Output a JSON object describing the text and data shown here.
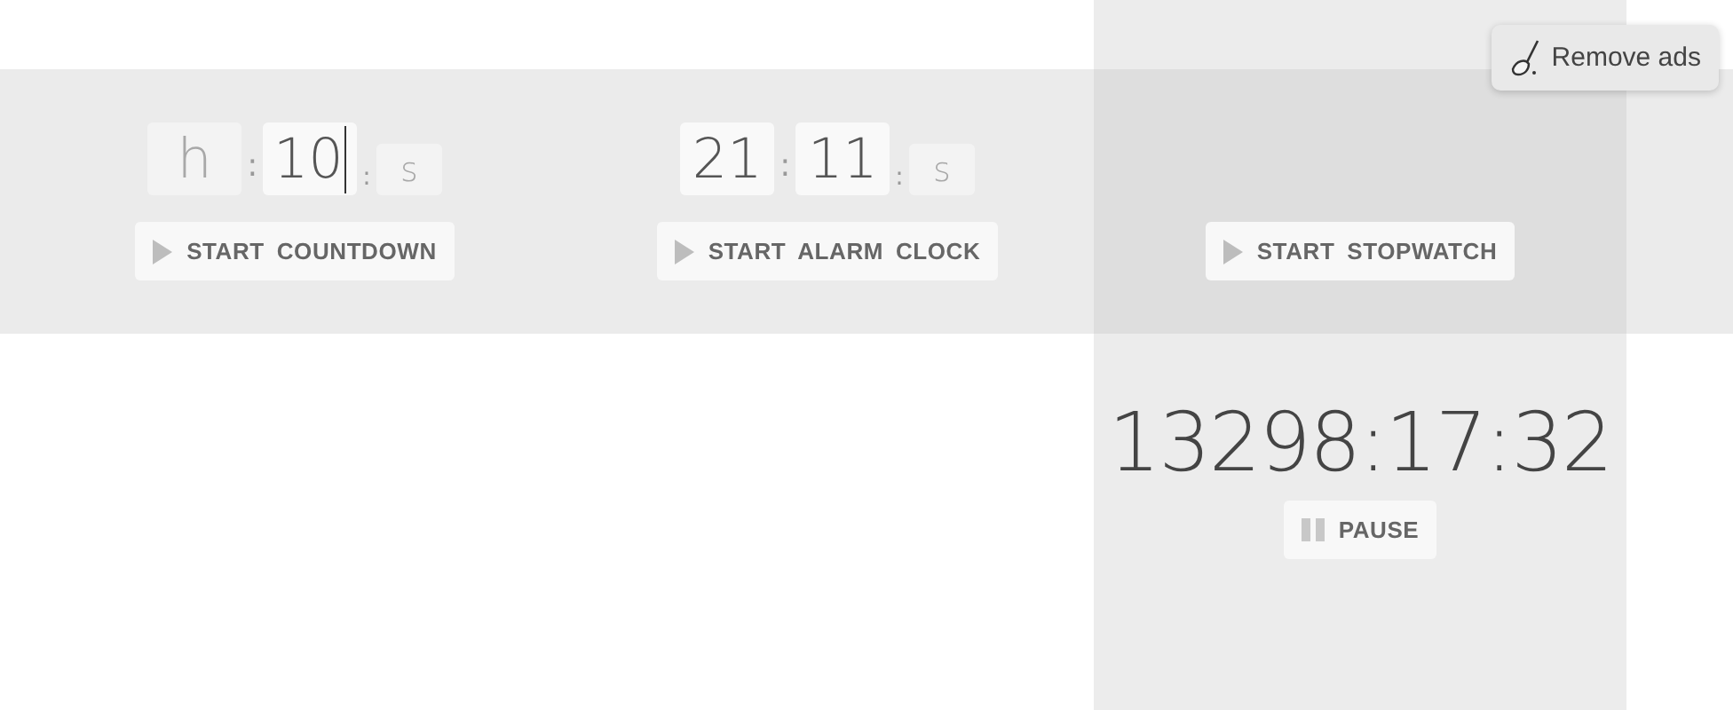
{
  "remove_ads": {
    "label": "Remove ads"
  },
  "panels": [
    {
      "kind": "countdown",
      "separators": [
        ":",
        ":"
      ],
      "fields": [
        {
          "placeholder": "h",
          "focused": false
        },
        {
          "value": "10",
          "focused": true
        },
        {
          "placeholder": "s",
          "focused": false
        }
      ],
      "button": {
        "label": "START COUNTDOWN"
      }
    },
    {
      "kind": "alarm",
      "separators": [
        ":",
        ":"
      ],
      "fields": [
        {
          "value": "21",
          "focused": false
        },
        {
          "value": "11",
          "focused": false
        },
        {
          "placeholder": "s",
          "focused": false
        }
      ],
      "button": {
        "label": "START ALARM CLOCK"
      }
    },
    {
      "kind": "stopwatch",
      "button": {
        "label": "START STOPWATCH"
      },
      "reading": "13298:17:32",
      "control": {
        "label": "PAUSE"
      }
    }
  ]
}
